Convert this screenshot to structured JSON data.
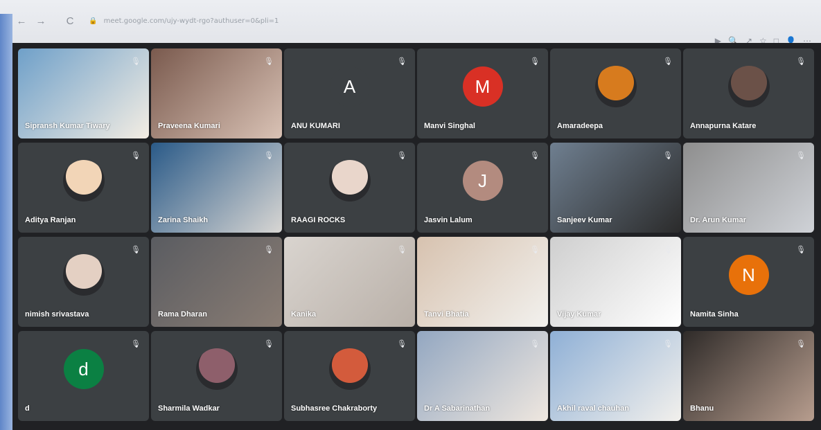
{
  "browser": {
    "url": "meet.google.com/ujy-wydt-rgo?authuser=0&pli=1",
    "back_glyph": "←",
    "forward_glyph": "→",
    "reload_glyph": "C",
    "lock_glyph": "🔒",
    "toolbar_glyphs": [
      "▶",
      "🔍",
      "↗",
      "☆",
      "□",
      "👤",
      "⋯"
    ]
  },
  "participants": [
    {
      "name": "Sipransh Kumar Tiwary",
      "type": "video",
      "colors": [
        "#6fa0c9",
        "#f3ede3"
      ]
    },
    {
      "name": "Praveena Kumari",
      "type": "video",
      "colors": [
        "#7a5a4e",
        "#d9c2b5"
      ]
    },
    {
      "name": "ANU KUMARI",
      "type": "letter",
      "letter": "A",
      "color": "#3c4043"
    },
    {
      "name": "Manvi Singhal",
      "type": "letter",
      "letter": "M",
      "color": "#d93025"
    },
    {
      "name": "Amaradeepa",
      "type": "image",
      "color": "#d77b1e"
    },
    {
      "name": "Annapurna Katare",
      "type": "image",
      "color": "#6b5148"
    },
    {
      "name": "Aditya Ranjan",
      "type": "image",
      "color": "#f2d5b7"
    },
    {
      "name": "Zarina Shaikh",
      "type": "video",
      "colors": [
        "#2a5a88",
        "#d8d6d3"
      ]
    },
    {
      "name": "RAAGI ROCKS",
      "type": "image",
      "color": "#e9d6cb"
    },
    {
      "name": "Jasvin Lalum",
      "type": "letter",
      "letter": "J",
      "color": "#b38b7f"
    },
    {
      "name": "Sanjeev Kumar",
      "type": "video",
      "colors": [
        "#6f7f90",
        "#2b2b2b"
      ]
    },
    {
      "name": "Dr. Arun Kumar",
      "type": "video",
      "colors": [
        "#8e8e8e",
        "#cfd2d7"
      ]
    },
    {
      "name": "nimish srivastava",
      "type": "image",
      "color": "#e4d0c3"
    },
    {
      "name": "Rama Dharan",
      "type": "video",
      "colors": [
        "#5a5c61",
        "#8a7d74"
      ]
    },
    {
      "name": "Kanika",
      "type": "video",
      "colors": [
        "#d9d4cf",
        "#b9b0a8"
      ]
    },
    {
      "name": "Tanvi Bhatia",
      "type": "video",
      "colors": [
        "#d7c2af",
        "#f2f1ee"
      ]
    },
    {
      "name": "Vijay Kumar",
      "type": "video",
      "colors": [
        "#cfcfcf",
        "#ffffff"
      ]
    },
    {
      "name": "Namita Sinha",
      "type": "letter",
      "letter": "N",
      "color": "#e8710a"
    },
    {
      "name": "d",
      "type": "letter",
      "letter": "d",
      "color": "#0b8043"
    },
    {
      "name": "Sharmila Wadkar",
      "type": "image",
      "color": "#8e5f6b"
    },
    {
      "name": "Subhasree Chakraborty",
      "type": "image",
      "color": "#d35b3c"
    },
    {
      "name": "Dr A Sabarinathan",
      "type": "video",
      "colors": [
        "#93a7c1",
        "#efe7df"
      ]
    },
    {
      "name": "Akhil raval chauhan",
      "type": "video",
      "colors": [
        "#8fb0d6",
        "#f2f0ec"
      ]
    },
    {
      "name": "Bhanu",
      "type": "video",
      "colors": [
        "#2f2b29",
        "#b79d8e"
      ]
    }
  ]
}
